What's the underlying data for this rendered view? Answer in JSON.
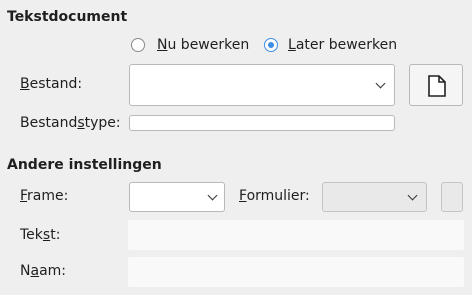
{
  "sections": {
    "text_document": "Tekstdocument",
    "other_settings": "Andere instellingen"
  },
  "edit_mode": {
    "now": {
      "pre": "",
      "ul": "N",
      "post": "u bewerken"
    },
    "later": {
      "pre": "",
      "ul": "L",
      "post": "ater bewerken"
    },
    "selected": "later"
  },
  "labels": {
    "file": {
      "pre": "",
      "ul": "B",
      "post": "estand:"
    },
    "file_type": {
      "pre": "Bestand",
      "ul": "s",
      "post": "type:"
    },
    "frame": {
      "pre": "",
      "ul": "F",
      "post": "rame:"
    },
    "form": {
      "pre": "",
      "ul": "F",
      "post": "ormulier:"
    },
    "text": {
      "pre": "Tek",
      "ul": "s",
      "post": "t:"
    },
    "name": {
      "pre": "N",
      "ul": "a",
      "post": "am:"
    }
  },
  "values": {
    "file": "",
    "file_type": "",
    "frame": "",
    "form": "",
    "text": "",
    "name": ""
  },
  "icons": {
    "browse": "document-icon",
    "dropdown": "chevron-down-icon"
  }
}
